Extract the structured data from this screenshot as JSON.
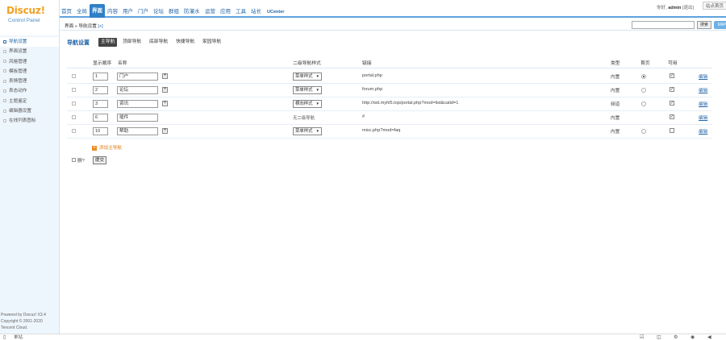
{
  "brand": {
    "logo": "Discuz!",
    "subtitle": "Control Panel"
  },
  "topnav": {
    "items": [
      "首页",
      "全局",
      "界面",
      "内容",
      "用户",
      "门户",
      "论坛",
      "群组",
      "防灌水",
      "运营",
      "应用",
      "工具",
      "站长",
      "UCenter"
    ],
    "active_index": 2,
    "user_label": "你好,",
    "username": "admin",
    "logout": "[退出]",
    "site_home": "站点首页"
  },
  "breadcrumb": {
    "text": "界面 » 导航设置",
    "plus": "[+]"
  },
  "search": {
    "button": "搜索",
    "map": "MAP"
  },
  "sidebar": {
    "items": [
      "导航设置",
      "界面设置",
      "风格管理",
      "模板管理",
      "表情管理",
      "表态动作",
      "主题鉴定",
      "编辑器设置",
      "在线列表图标"
    ],
    "active_index": 0
  },
  "main": {
    "title": "导航设置",
    "tabs": [
      "主导航",
      "顶部导航",
      "底部导航",
      "快捷导航",
      "家园导航"
    ],
    "active_tab": 0,
    "headers": {
      "order": "显示顺序",
      "name": "名称",
      "sub_style": "二级导航样式",
      "link": "链接",
      "type": "类型",
      "home": "首页",
      "available": "可用"
    },
    "rows": [
      {
        "order": "1",
        "name": "门户",
        "style": "菜单样式",
        "style_select": true,
        "link": "portal.php",
        "type": "内置",
        "home": true,
        "available": true,
        "edit": "编辑"
      },
      {
        "order": "2",
        "name": "论坛",
        "style": "菜单样式",
        "style_select": true,
        "link": "forum.php",
        "type": "内置",
        "home": false,
        "available": true,
        "edit": "编辑"
      },
      {
        "order": "3",
        "name": "资讯",
        "style": "横向样式",
        "style_select": true,
        "link": "http://wd.myhl5.top/portal.php?mod=list&catid=1",
        "type": "频道",
        "home": false,
        "available": true,
        "edit": "编辑"
      },
      {
        "order": "6",
        "name": "插件",
        "style": "无二级导航",
        "style_select": false,
        "link": "#",
        "type": "内置",
        "home": null,
        "available": true,
        "edit": "编辑"
      },
      {
        "order": "10",
        "name": "帮助",
        "style": "菜单样式",
        "style_select": true,
        "link": "misc.php?mod=faq",
        "type": "内置",
        "home": false,
        "available": false,
        "edit": "编辑"
      }
    ],
    "add_main_nav": "添加主导航",
    "delete_label": "删?",
    "submit": "提交"
  },
  "footer": {
    "powered": "Powered by Discuz! X3.4",
    "copyright": "Copyright © 2001-2020",
    "company": "Tencent Cloud."
  },
  "bottombar": {
    "label": "单站"
  }
}
